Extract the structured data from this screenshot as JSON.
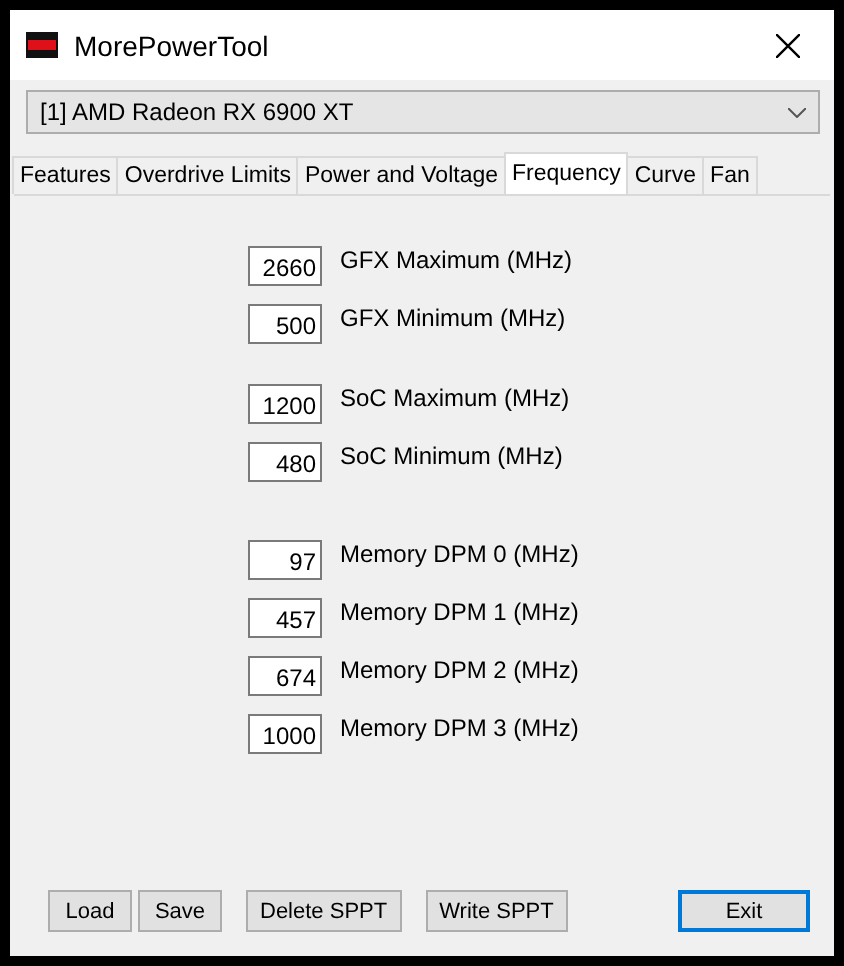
{
  "window": {
    "title": "MorePowerTool"
  },
  "device_select": {
    "value": "[1] AMD Radeon RX 6900 XT"
  },
  "tabs": [
    {
      "label": "Features",
      "selected": false
    },
    {
      "label": "Overdrive Limits",
      "selected": false
    },
    {
      "label": "Power and Voltage",
      "selected": false
    },
    {
      "label": "Frequency",
      "selected": true
    },
    {
      "label": "Curve",
      "selected": false
    },
    {
      "label": "Fan",
      "selected": false
    }
  ],
  "field_groups": [
    [
      {
        "value": "2660",
        "label": "GFX Maximum (MHz)"
      },
      {
        "value": "500",
        "label": "GFX Minimum (MHz)"
      }
    ],
    [
      {
        "value": "1200",
        "label": "SoC Maximum (MHz)"
      },
      {
        "value": "480",
        "label": "SoC Minimum (MHz)"
      }
    ],
    [
      {
        "value": "97",
        "label": "Memory DPM 0 (MHz)"
      },
      {
        "value": "457",
        "label": "Memory DPM 1 (MHz)"
      },
      {
        "value": "674",
        "label": "Memory DPM 2 (MHz)"
      },
      {
        "value": "1000",
        "label": "Memory DPM 3 (MHz)"
      }
    ]
  ],
  "button_groups": [
    [
      {
        "label": "Load",
        "focused": false
      },
      {
        "label": "Save",
        "focused": false
      }
    ],
    [
      {
        "label": "Delete SPPT",
        "focused": false
      }
    ],
    [
      {
        "label": "Write SPPT",
        "focused": false
      }
    ]
  ],
  "exit_button": {
    "label": "Exit",
    "focused": true
  }
}
